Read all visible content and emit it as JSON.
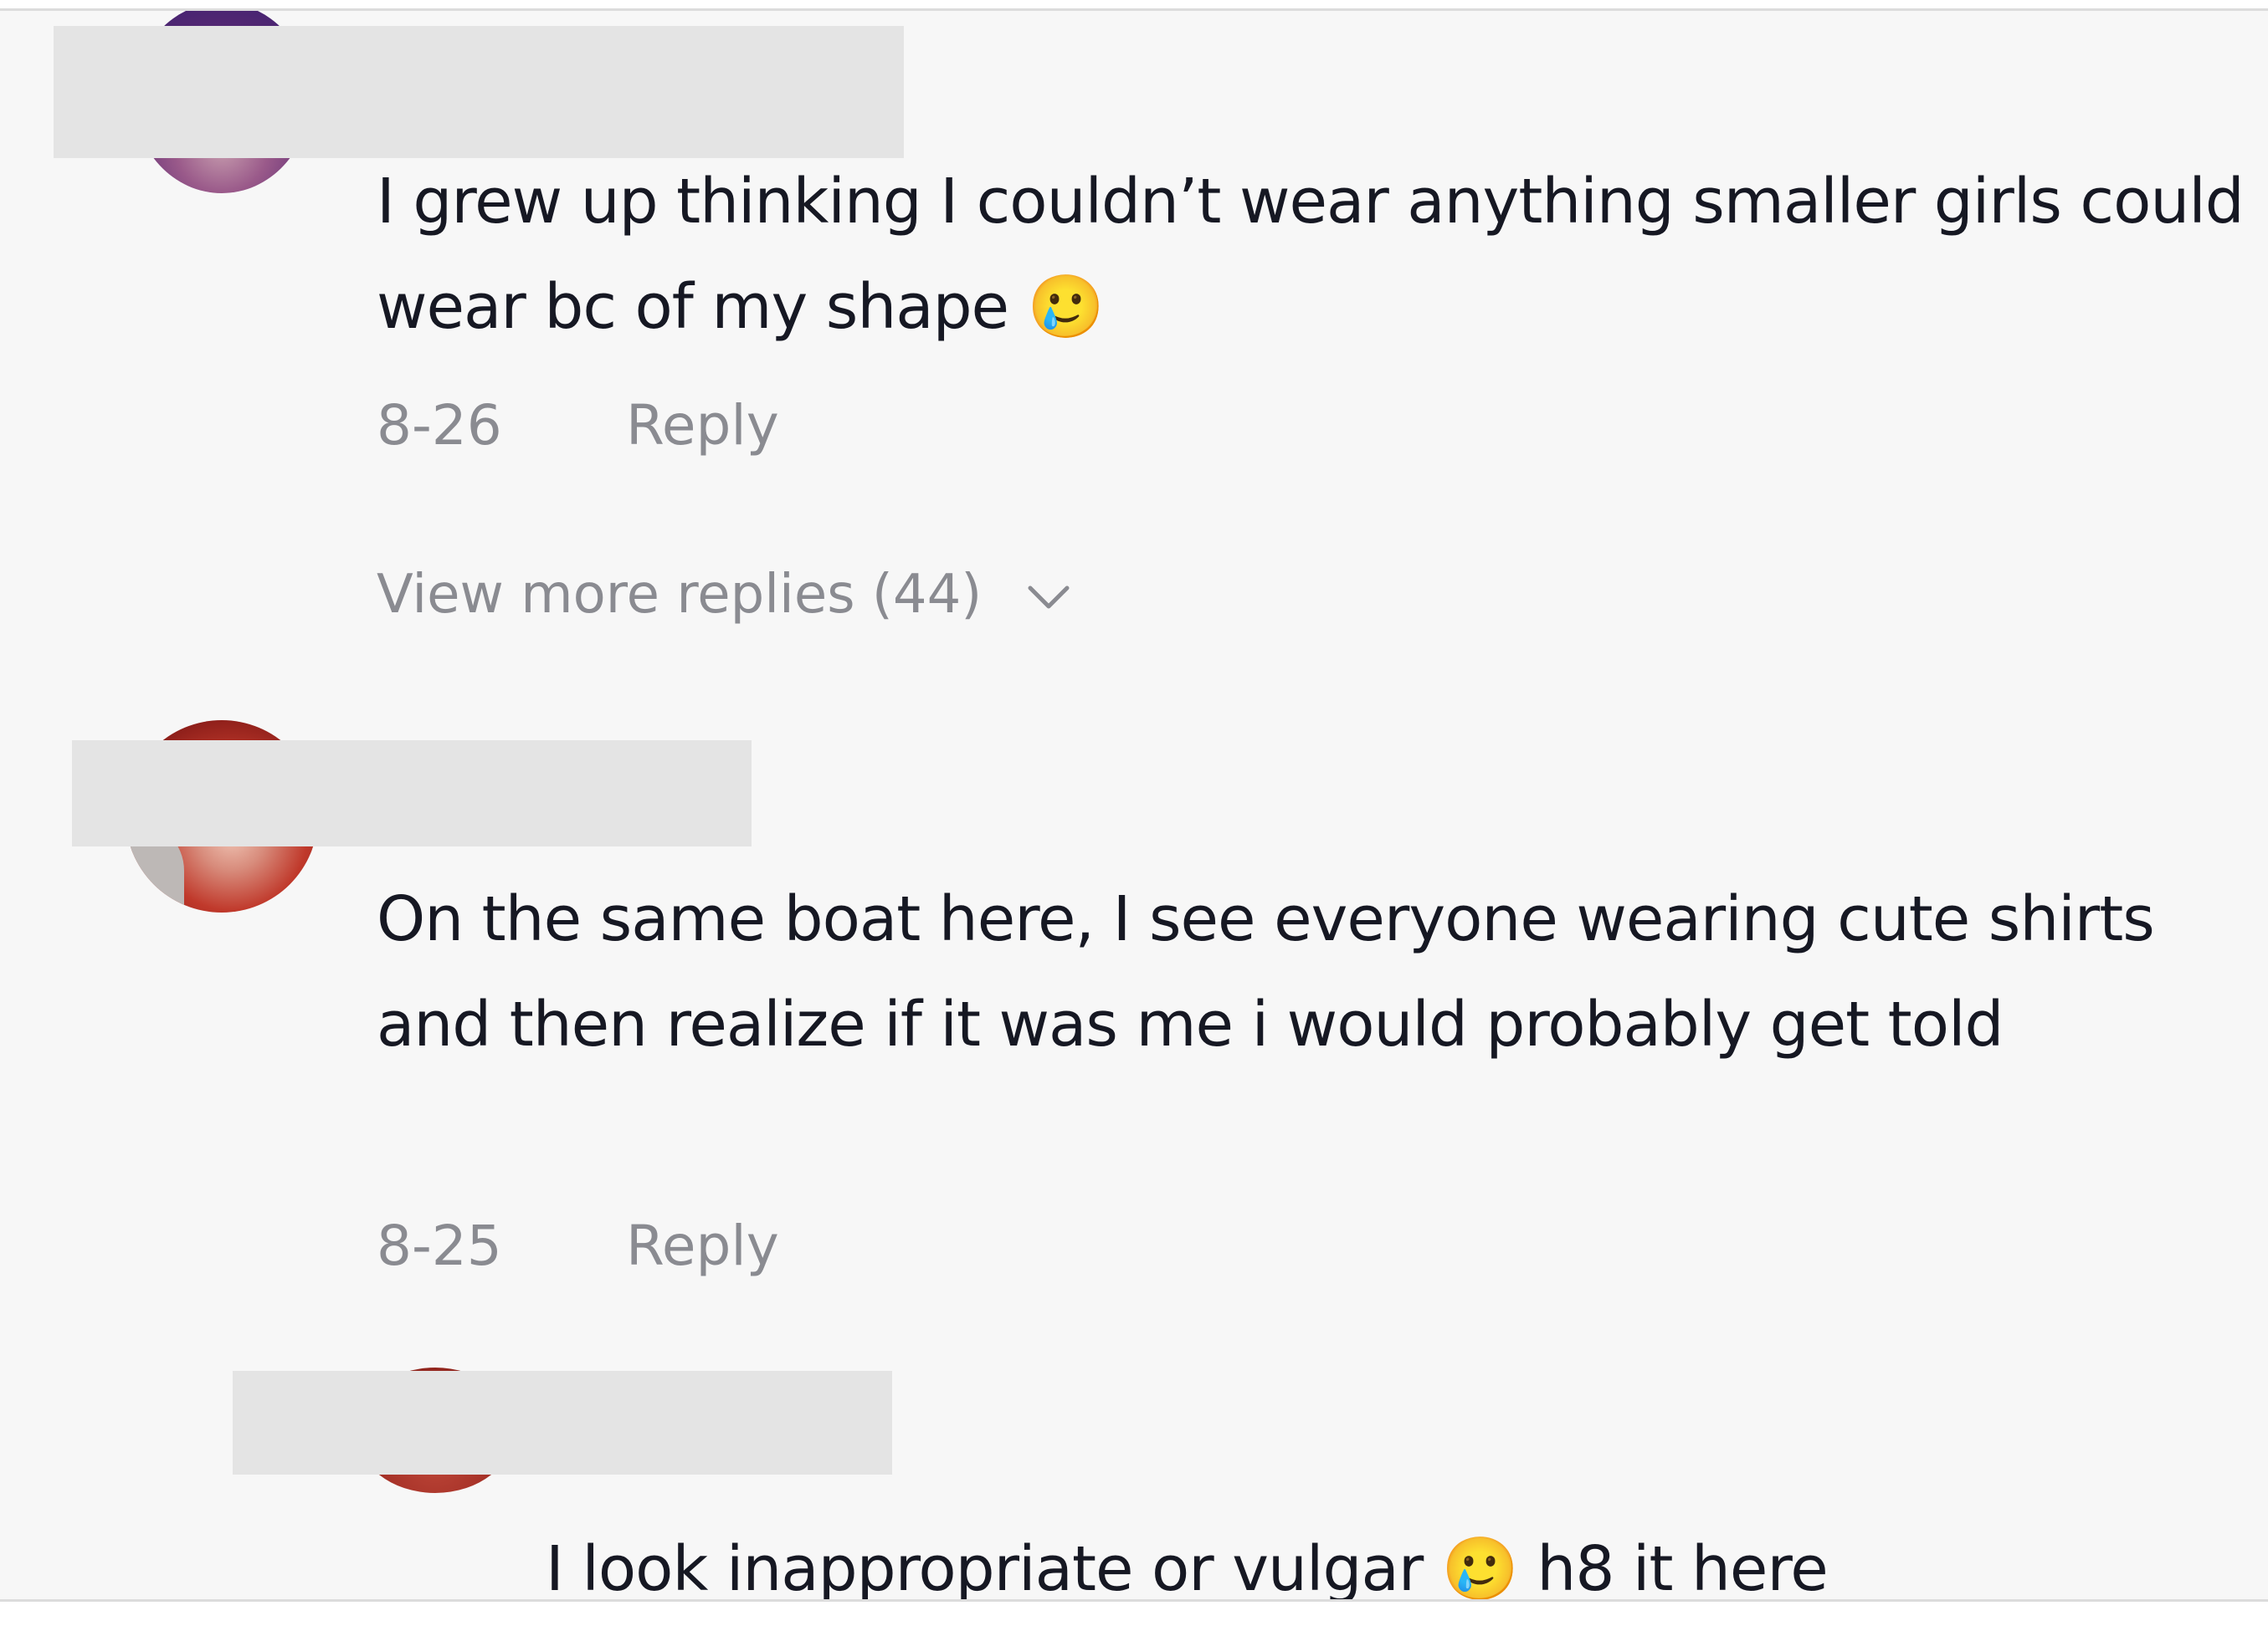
{
  "comments": [
    {
      "text": "I grew up thinking I couldn’t wear anything smaller girls could wear bc of my shape 🥲",
      "date": "8-26",
      "reply_label": "Reply",
      "view_more_label": "View more replies (44)"
    },
    {
      "text": "On the same boat here, I see everyone wearing cute shirts and then realize if it was me i would probably get told",
      "date": "8-25",
      "reply_label": "Reply"
    },
    {
      "text": "I look inappropriate or vulgar 🥲 h8 it here"
    }
  ],
  "colors": {
    "panel_background": "#f7f7f7",
    "text_primary": "#161823",
    "text_secondary": "#8a8b91",
    "redaction": "#e4e4e4"
  },
  "icons": {
    "expand": "chevron-down-icon"
  }
}
